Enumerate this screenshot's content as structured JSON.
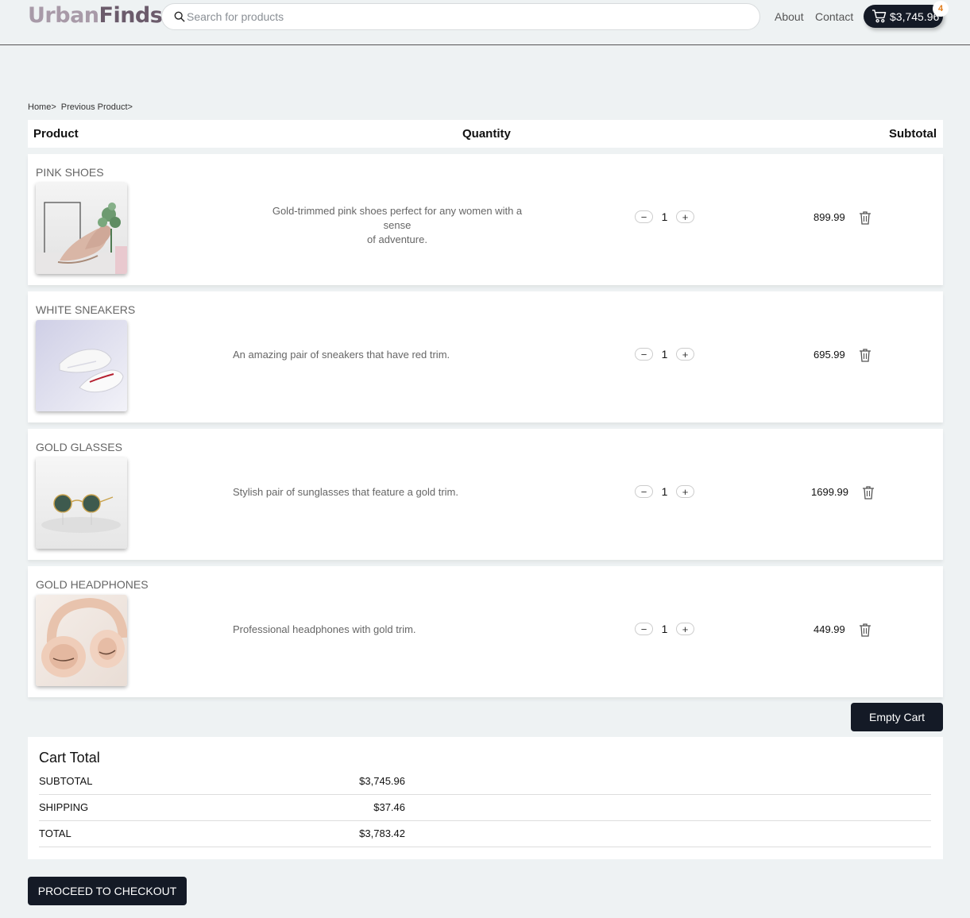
{
  "header": {
    "logo_part1": "Urban",
    "logo_part2": "Finds",
    "search_placeholder": "Search for products",
    "nav": [
      "About",
      "Contact"
    ],
    "cart_total": "$3,745.96",
    "cart_count": "4"
  },
  "breadcrumb": [
    "Home>",
    "Previous Product>"
  ],
  "table": {
    "col_product": "Product",
    "col_quantity": "Quantity",
    "col_subtotal": "Subtotal"
  },
  "items": [
    {
      "name": "PINK SHOES",
      "description_line1": "Gold-trimmed pink shoes perfect for any women with a sense",
      "description_line2": "of adventure.",
      "quantity": "1",
      "price": "899.99",
      "image_icon": "pink-shoes-image"
    },
    {
      "name": "WHITE SNEAKERS",
      "description_line1": "An amazing pair of sneakers that have red trim.",
      "description_line2": "",
      "quantity": "1",
      "price": "695.99",
      "image_icon": "white-sneakers-image"
    },
    {
      "name": "GOLD GLASSES",
      "description_line1": "Stylish pair of sunglasses that feature a gold trim.",
      "description_line2": "",
      "quantity": "1",
      "price": "1699.99",
      "image_icon": "gold-glasses-image"
    },
    {
      "name": "GOLD HEADPHONES",
      "description_line1": "Professional headphones with gold trim.",
      "description_line2": "",
      "quantity": "1",
      "price": "449.99",
      "image_icon": "gold-headphones-image"
    }
  ],
  "qty_minus": "−",
  "qty_plus": "+",
  "empty_cart_label": "Empty Cart",
  "cart_total_section": {
    "title": "Cart Total",
    "subtotal_label": "SUBTOTAL",
    "subtotal_value": "$3,745.96",
    "shipping_label": "SHIPPING",
    "shipping_value": "$37.46",
    "total_label": "TOTAL",
    "total_value": "$3,783.42"
  },
  "checkout_label": "PROCEED TO CHECKOUT",
  "colors": {
    "primary_dark": "#141a26",
    "badge_orange": "#e07b1a",
    "background": "#eef2f3"
  }
}
